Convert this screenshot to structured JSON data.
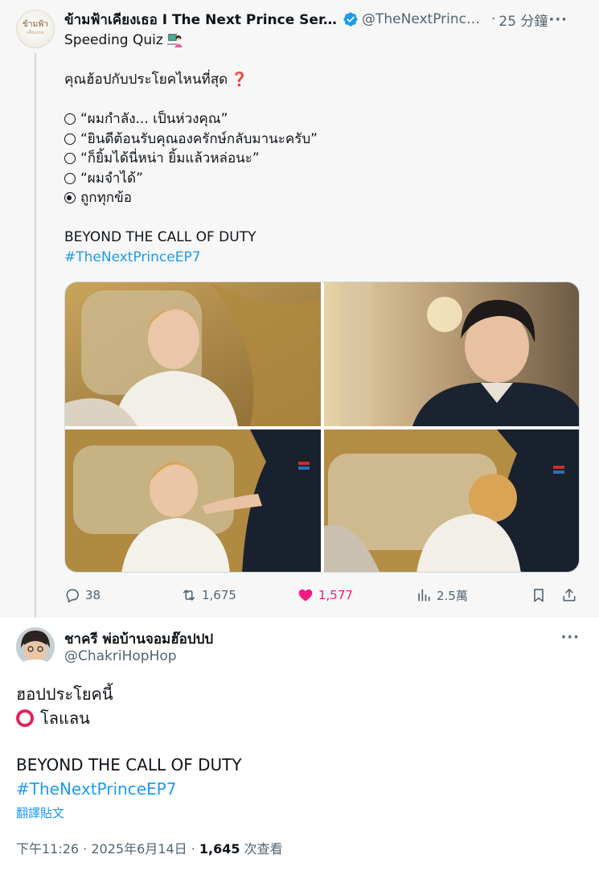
{
  "parent_tweet": {
    "author_name": "ข้ามฟ้าเคียงเธอ I The Next Prince Ser...",
    "handle": "@TheNextPrince...",
    "time_ago": "25 分鐘",
    "avatar_logo_text": "ข้ามฟ้า",
    "avatar_logo_sub": "เคียงเธอ",
    "lines": {
      "l1": "Speeding Quiz",
      "l2": "คุณฮ้อปกับประโยคไหนที่สุด",
      "opt1": "“ผมกำลัง... เป็นห่วงคุณ”",
      "opt2": "“ยินดีต้อนรับคุณองครักษ์กลับมานะครับ”",
      "opt3": "“ก็ยิ้มได้นี่หน่า ยิ้มแล้วหล่อนะ”",
      "opt4": "“ผมจำได้”",
      "opt5": "ถูกทุกข้อ",
      "tagline": "BEYOND THE CALL OF DUTY",
      "hashtag": "#TheNextPrinceEP7"
    },
    "stats": {
      "replies": "38",
      "reposts": "1,675",
      "likes": "1,577",
      "views": "2.5萬"
    },
    "icons": [
      "verified-badge-icon",
      "speech-bubble-icon",
      "repost-icon",
      "heart-icon",
      "bar-chart-icon",
      "bookmark-icon",
      "share-icon",
      "more-icon"
    ]
  },
  "reply_tweet": {
    "author_name": "ชาครี พ่อบ้านจอมฮ๊อปปป",
    "handle": "@ChakriHopHop",
    "line1": "ฮอปประโยคนี้",
    "line2": "โลแลน",
    "tagline": "BEYOND THE CALL OF DUTY",
    "hashtag": "#TheNextPrinceEP7",
    "translate": "翻譯貼文",
    "timestamp": "下午11:26 · 2025年6月14日 · ",
    "views_count": "1,645",
    "views_label": " 次查看"
  },
  "colors": {
    "accent": "#1d9bf0",
    "like": "#f91880",
    "muted": "#536471",
    "text": "#0f1419",
    "ring": "#e0245e"
  }
}
